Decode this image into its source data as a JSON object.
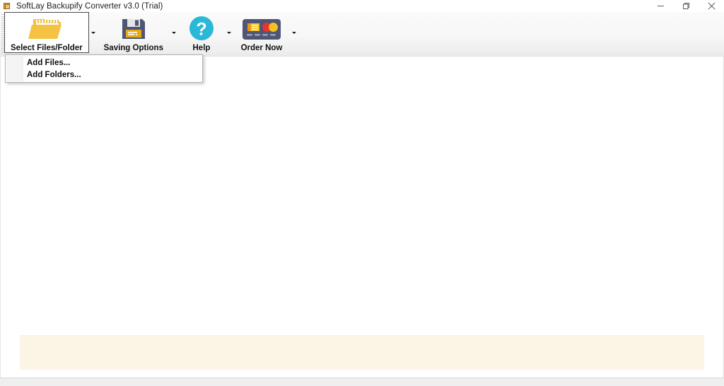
{
  "window": {
    "title": "SoftLay Backupify Converter v3.0 (Trial)",
    "app_icon": "app-folder-icon",
    "controls": {
      "minimize_label": "Minimize",
      "restore_label": "Restore",
      "close_label": "Close"
    }
  },
  "toolbar": {
    "buttons": [
      {
        "id": "select-files-folder",
        "label": "Select Files/Folder",
        "icon": "open-folder-icon",
        "has_dropdown": true,
        "active": true
      },
      {
        "id": "saving-options",
        "label": "Saving Options",
        "icon": "floppy-disk-save-icon",
        "has_dropdown": true,
        "active": false
      },
      {
        "id": "help",
        "label": "Help",
        "icon": "question-mark-circle-icon",
        "has_dropdown": true,
        "active": false
      },
      {
        "id": "order-now",
        "label": "Order Now",
        "icon": "credit-card-icon",
        "has_dropdown": true,
        "active": false
      }
    ]
  },
  "dropdown_menu": {
    "owner": "select-files-folder",
    "items": [
      {
        "id": "add-files",
        "label": "Add Files..."
      },
      {
        "id": "add-folders",
        "label": "Add Folders..."
      }
    ]
  },
  "content": {
    "file_list": {
      "empty_text": ""
    },
    "notice_bar": {
      "text": ""
    }
  },
  "colors": {
    "accent_yellow": "#f3c13a",
    "folder_yellow": "#f5c243",
    "help_cyan": "#29b8d8",
    "card_slate": "#4e5674",
    "notice_cream": "#fcf4e4",
    "toolbar_gray": "#f4f4f4",
    "title_text": "#1b1b1b"
  }
}
